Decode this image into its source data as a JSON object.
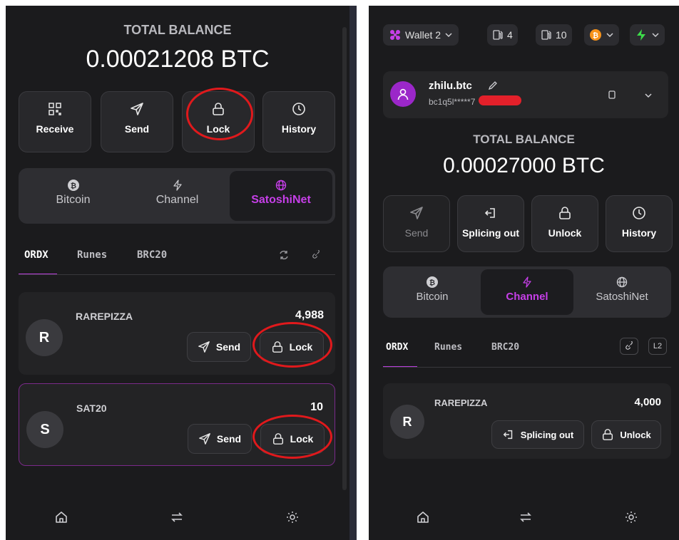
{
  "left": {
    "total_label": "TOTAL BALANCE",
    "balance": "0.00021208 BTC",
    "actions": [
      {
        "label": "Receive",
        "icon": "qr-code-icon"
      },
      {
        "label": "Send",
        "icon": "send-icon"
      },
      {
        "label": "Lock",
        "icon": "lock-icon"
      },
      {
        "label": "History",
        "icon": "clock-icon"
      }
    ],
    "networks": [
      {
        "label": "Bitcoin",
        "icon": "bitcoin-icon"
      },
      {
        "label": "Channel",
        "icon": "lightning-icon"
      },
      {
        "label": "SatoshiNet",
        "icon": "globe-icon",
        "active": true
      }
    ],
    "asset_tabs": [
      "ORDX",
      "Runes",
      "BRC20"
    ],
    "assets": [
      {
        "initial": "R",
        "name": "RAREPIZZA",
        "amount": "4,988",
        "send_label": "Send",
        "lock_label": "Lock"
      },
      {
        "initial": "S",
        "name": "SAT20",
        "amount": "10",
        "send_label": "Send",
        "lock_label": "Lock"
      }
    ]
  },
  "right": {
    "wallet_label": "Wallet 2",
    "chip_a": "4",
    "chip_b": "10",
    "account_name": "zhilu.btc",
    "account_address": "bc1q5l*****7",
    "total_label": "TOTAL BALANCE",
    "balance": "0.00027000 BTC",
    "actions": [
      {
        "label": "Send",
        "icon": "send-icon",
        "disabled": true
      },
      {
        "label": "Splicing out",
        "icon": "splice-out-icon"
      },
      {
        "label": "Unlock",
        "icon": "unlock-icon"
      },
      {
        "label": "History",
        "icon": "clock-icon"
      }
    ],
    "networks": [
      {
        "label": "Bitcoin",
        "icon": "bitcoin-icon"
      },
      {
        "label": "Channel",
        "icon": "lightning-icon",
        "active": true
      },
      {
        "label": "SatoshiNet",
        "icon": "globe-icon"
      }
    ],
    "asset_tabs": [
      "ORDX",
      "Runes",
      "BRC20"
    ],
    "l2_label": "L2",
    "assets": [
      {
        "initial": "R",
        "name": "RAREPIZZA",
        "amount": "4,000",
        "splice_label": "Splicing out",
        "unlock_label": "Unlock"
      }
    ]
  },
  "colors": {
    "accent": "#c63fe8",
    "highlight_circle": "#e0191c",
    "bitcoin": "#f7931a",
    "lightning": "#3ddc4a"
  }
}
